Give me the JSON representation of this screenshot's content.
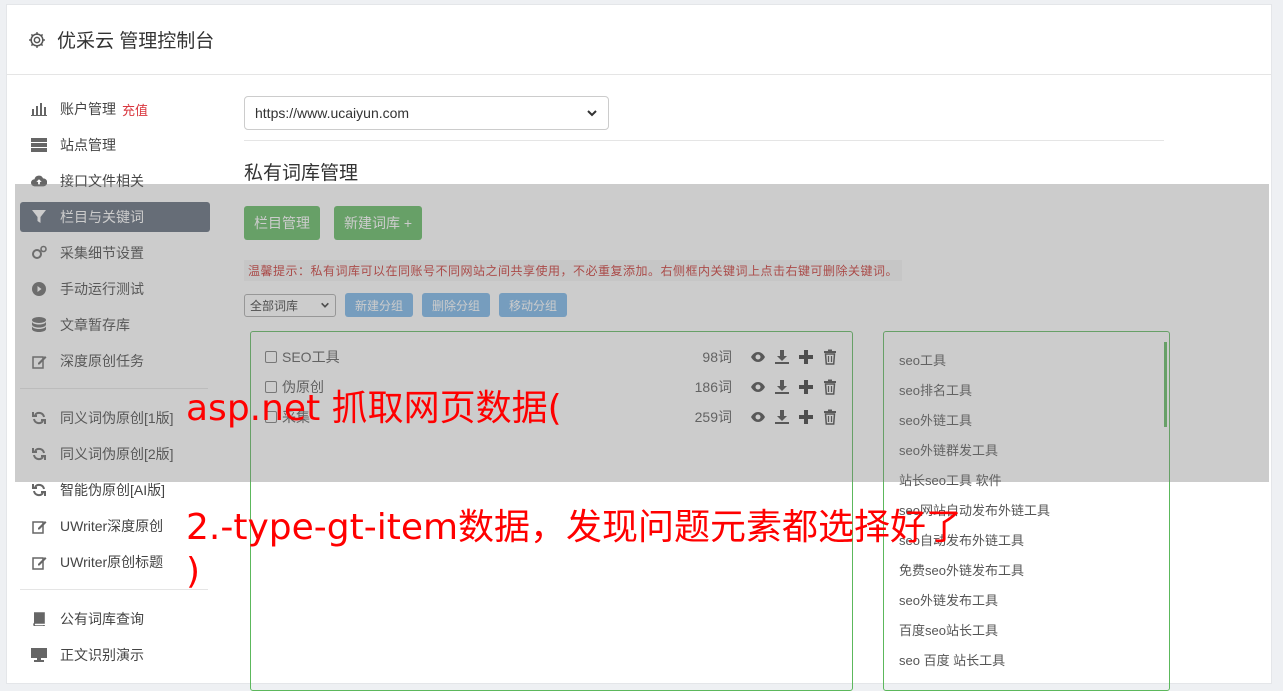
{
  "header": {
    "title": "优采云 管理控制台"
  },
  "sidebar": {
    "account": {
      "label": "账户管理",
      "badge": "充值"
    },
    "group1": [
      {
        "label": "站点管理",
        "icon": "server-icon"
      },
      {
        "label": "接口文件相关",
        "icon": "cloud-upload-icon"
      },
      {
        "label": "栏目与关键词",
        "icon": "filter-icon",
        "active": true
      },
      {
        "label": "采集细节设置",
        "icon": "gears-icon"
      },
      {
        "label": "手动运行测试",
        "icon": "play-circle-icon"
      },
      {
        "label": "文章暂存库",
        "icon": "database-icon"
      },
      {
        "label": "深度原创任务",
        "icon": "edit-icon"
      }
    ],
    "group2": [
      {
        "label": "同义词伪原创[1版]",
        "icon": "refresh-icon"
      },
      {
        "label": "同义词伪原创[2版]",
        "icon": "refresh-icon"
      },
      {
        "label": "智能伪原创[AI版]",
        "icon": "refresh-icon"
      },
      {
        "label": "UWriter深度原创",
        "icon": "edit-icon"
      },
      {
        "label": "UWriter原创标题",
        "icon": "edit-icon"
      }
    ],
    "group3": [
      {
        "label": "公有词库查询",
        "icon": "book-icon"
      },
      {
        "label": "正文识别演示",
        "icon": "monitor-icon"
      }
    ]
  },
  "main": {
    "site_select": "https://www.ucaiyun.com",
    "page_title": "私有词库管理",
    "btn_columns": "栏目管理",
    "btn_new_lib": "新建词库 +",
    "tip": "温馨提示：私有词库可以在同账号不同网站之间共享使用，不必重复添加。右侧框内关键词上点击右键可删除关键词。",
    "lib_filter": "全部词库",
    "btn_new_group": "新建分组",
    "btn_delete_group": "删除分组",
    "btn_move_group": "移动分组",
    "libraries": [
      {
        "name": "SEO工具",
        "count": "98词"
      },
      {
        "name": "伪原创",
        "count": "186词"
      },
      {
        "name": "采集",
        "count": "259词"
      }
    ],
    "keywords": [
      "seo工具",
      "seo排名工具",
      "seo外链工具",
      "seo外链群发工具",
      "站长seo工具 软件",
      "seo网站自动发布外链工具",
      "seo自动发布外链工具",
      "免费seo外链发布工具",
      "seo外链发布工具",
      "百度seo站长工具",
      "seo 百度 站长工具"
    ]
  },
  "overlay_caption": {
    "line1": "asp.net 抓取网页数据(",
    "line2": "2.-type-gt-item数据，发现问题元素都选择好了",
    "line3": ")"
  },
  "colors": {
    "green": "#5cb85c",
    "active_nav": "#5b6677",
    "blue_btn": "#74b3e8",
    "red": "#ff0000"
  }
}
